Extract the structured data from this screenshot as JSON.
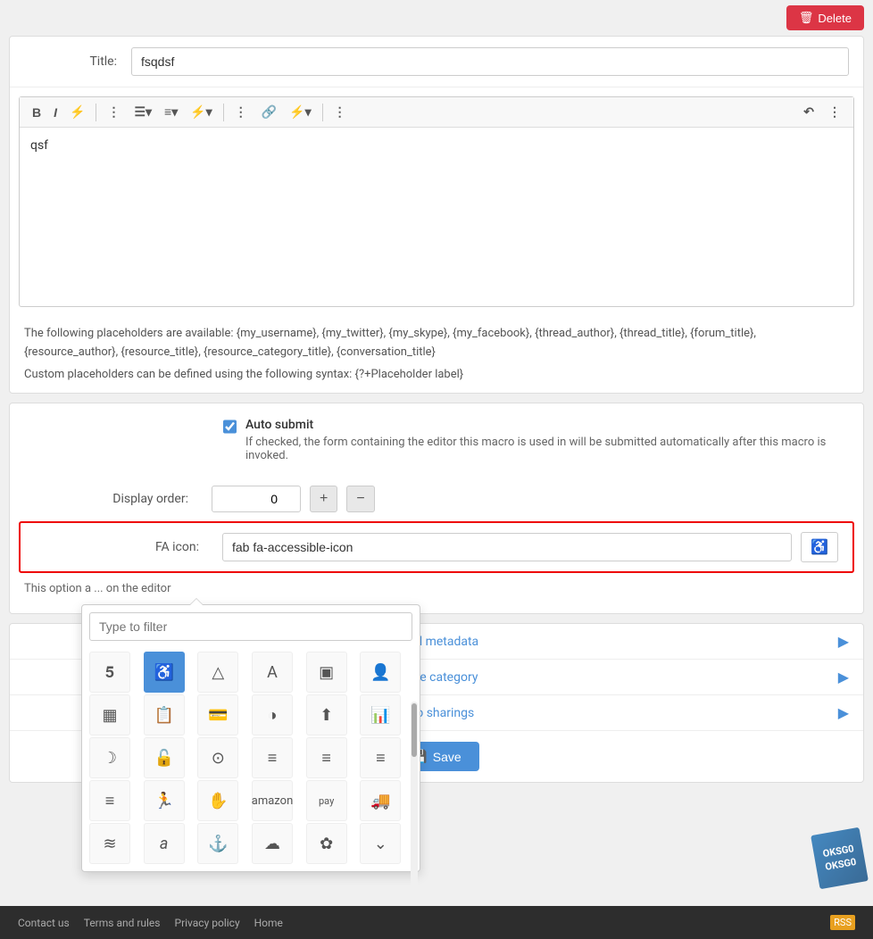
{
  "top": {
    "delete_label": "Delete"
  },
  "title_row": {
    "label": "Title:",
    "value": "fsqdsf"
  },
  "editor": {
    "content": "qsf",
    "toolbar": {
      "bold": "B",
      "italic": "I",
      "more1": "⚡",
      "dots1": "⋮",
      "list": "☰",
      "align": "≡",
      "more2": "⚡",
      "dots2": "⋮",
      "link": "🔗",
      "more3": "⚡",
      "dots3": "⋮",
      "undo": "↶",
      "dots4": "⋮"
    }
  },
  "placeholder_text": "{my_username}, {my_twitter}, {my_skype}, {my_facebook}, {thread_author}, {thread_title}, {forum_title}, {resource_author}, {resource_title}, {resource_category_title}, {conversation_title}",
  "placeholder_note": "Custom placeholders can be defined using the following syntax: {?+Placeholder label}",
  "autosubmit": {
    "label": "Auto submit",
    "description": "If checked, the form containing the editor this macro is used in will be submitted automatically after this macro is invoked.",
    "checked": true
  },
  "display_order": {
    "label": "Display order:",
    "value": "0",
    "plus": "+",
    "minus": "−"
  },
  "fa_icon": {
    "label": "FA icon:",
    "value": "fab fa-accessible-icon",
    "description": "This option a",
    "description2": "on the editor"
  },
  "icon_picker": {
    "filter_placeholder": "Type to filter",
    "icons": [
      "♿",
      "♿",
      "△",
      "A",
      "▣",
      "👤",
      "▦",
      "📋",
      "💳",
      "◑",
      "⬆",
      "📊",
      "☽",
      "🔓",
      "⊙",
      "≡",
      "≡",
      "≡",
      "≡",
      "🏃",
      "✋",
      "a",
      "pay",
      "🚚",
      "≋",
      "a",
      "⚓",
      "☁",
      "✿",
      "⌄"
    ]
  },
  "menu_items": [
    {
      "label": "Thread metadata",
      "arrow": "▶"
    },
    {
      "label": "Change category",
      "arrow": "▶"
    },
    {
      "label": "Macro sharings",
      "arrow": "▶"
    }
  ],
  "save": {
    "label": "Save"
  },
  "footer": {
    "contact": "Contact us",
    "terms": "Terms and rules",
    "privacy": "Privacy policy",
    "home": "Home",
    "rss": "RSS"
  }
}
